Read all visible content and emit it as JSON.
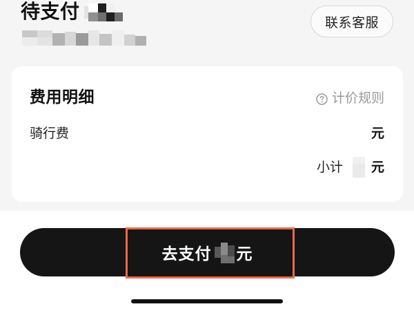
{
  "header": {
    "status_title": "待支付",
    "contact_button": "联系客服"
  },
  "fee_card": {
    "title": "费用明细",
    "pricing_rules_label": "计价规则",
    "riding_fee_label": "骑行费",
    "riding_fee_unit": "元",
    "subtotal_label": "小计",
    "subtotal_unit": "元"
  },
  "footer": {
    "pay_button_prefix": "去支付",
    "pay_button_unit": "元"
  },
  "icons": {
    "pricing_rules": "question-circle-icon"
  },
  "colors": {
    "page_background": "#f5f5f5",
    "card_background": "#ffffff",
    "primary_text": "#111111",
    "secondary_text": "#999999",
    "button_background": "#151515",
    "highlight_border": "#ee6a45"
  }
}
